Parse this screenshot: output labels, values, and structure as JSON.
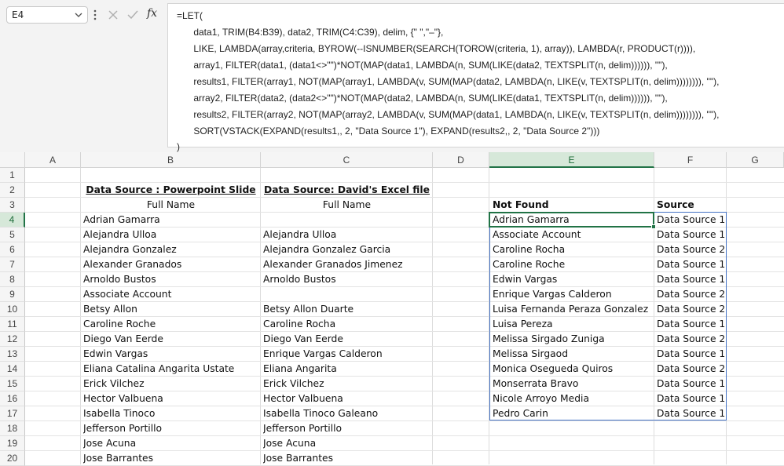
{
  "namebox": {
    "value": "E4"
  },
  "formula": {
    "fx_label": "fx",
    "lines": [
      "=LET(",
      "    data1, TRIM(B4:B39), data2, TRIM(C4:C39), delim, {\" \",\"–\"},",
      "    LIKE, LAMBDA(array,criteria, BYROW(--ISNUMBER(SEARCH(TOROW(criteria, 1), array)), LAMBDA(r, PRODUCT(r)))),",
      "    array1, FILTER(data1, (data1<>\"\")*NOT(MAP(data1, LAMBDA(n, SUM(LIKE(data2, TEXTSPLIT(n, delim)))))), \"\"),",
      "    results1, FILTER(array1, NOT(MAP(array1, LAMBDA(v, SUM(MAP(data2, LAMBDA(n, LIKE(v, TEXTSPLIT(n, delim)))))))), \"\"),",
      "    array2, FILTER(data2, (data2<>\"\")*NOT(MAP(data2, LAMBDA(n, SUM(LIKE(data1, TEXTSPLIT(n, delim)))))), \"\"),",
      "    results2, FILTER(array2, NOT(MAP(array2, LAMBDA(v, SUM(MAP(data1, LAMBDA(n, LIKE(v, TEXTSPLIT(n, delim)))))))), \"\"),",
      "    SORT(VSTACK(EXPAND(results1,, 2, \"Data Source 1\"), EXPAND(results2,, 2, \"Data Source 2\")))",
      ")"
    ]
  },
  "columns": [
    "A",
    "B",
    "C",
    "D",
    "E",
    "F",
    "G"
  ],
  "rows": [
    "1",
    "2",
    "3",
    "4",
    "5",
    "6",
    "7",
    "8",
    "9",
    "10",
    "11",
    "12",
    "13",
    "14",
    "15",
    "16",
    "17",
    "18",
    "19",
    "20"
  ],
  "headers": {
    "b2": "Data Source :  Powerpoint Slide",
    "c2": "Data Source: David's Excel file ",
    "b3": "Full Name",
    "c3": "Full Name",
    "e3": "Not Found",
    "f3": "Source"
  },
  "source_b": [
    "Adrian Gamarra",
    "Alejandra Ulloa",
    "Alejandra Gonzalez",
    "Alexander Granados",
    "Arnoldo Bustos",
    "Associate Account",
    "Betsy Allon",
    "Caroline Roche",
    "Diego Van Eerde",
    "Edwin  Vargas",
    "Eliana Catalina Angarita Ustate",
    "Erick Vilchez",
    "Hector Valbuena",
    "Isabella Tinoco",
    "Jefferson Portillo",
    "Jose Acuna",
    "Jose Barrantes"
  ],
  "source_c": [
    "",
    "Alejandra Ulloa",
    "Alejandra Gonzalez Garcia",
    "Alexander Granados Jimenez",
    "Arnoldo Bustos",
    "",
    "Betsy Allon Duarte",
    "Caroline Rocha",
    "Diego Van Eerde",
    "Enrique Vargas Calderon",
    "Eliana Angarita",
    "Erick Vilchez",
    "Hector Valbuena",
    "Isabella Tinoco Galeano",
    "Jefferson Portillo",
    "Jose Acuna",
    "Jose Barrantes"
  ],
  "results": [
    {
      "name": "Adrian Gamarra",
      "source": "Data Source 1"
    },
    {
      "name": "Associate Account",
      "source": "Data Source 1"
    },
    {
      "name": "Caroline Rocha",
      "source": "Data Source 2"
    },
    {
      "name": "Caroline Roche",
      "source": "Data Source 1"
    },
    {
      "name": "Edwin Vargas",
      "source": "Data Source 1"
    },
    {
      "name": "Enrique Vargas Calderon",
      "source": "Data Source 2"
    },
    {
      "name": "Luisa Fernanda Peraza Gonzalez",
      "source": "Data Source 2"
    },
    {
      "name": "Luisa Pereza",
      "source": "Data Source 1"
    },
    {
      "name": "Melissa Sirgado Zuniga",
      "source": "Data Source 2"
    },
    {
      "name": "Melissa Sirgaod",
      "source": "Data Source 1"
    },
    {
      "name": "Monica Osegueda Quiros",
      "source": "Data Source 2"
    },
    {
      "name": "Monserrata Bravo",
      "source": "Data Source 1"
    },
    {
      "name": "Nicole Arroyo Media",
      "source": "Data Source 1"
    },
    {
      "name": "Pedro Carin",
      "source": "Data Source 1"
    }
  ],
  "colors": {
    "selection": "#217346",
    "spill_border": "#4472c4",
    "header_selected_bg": "#d6e8d9"
  }
}
